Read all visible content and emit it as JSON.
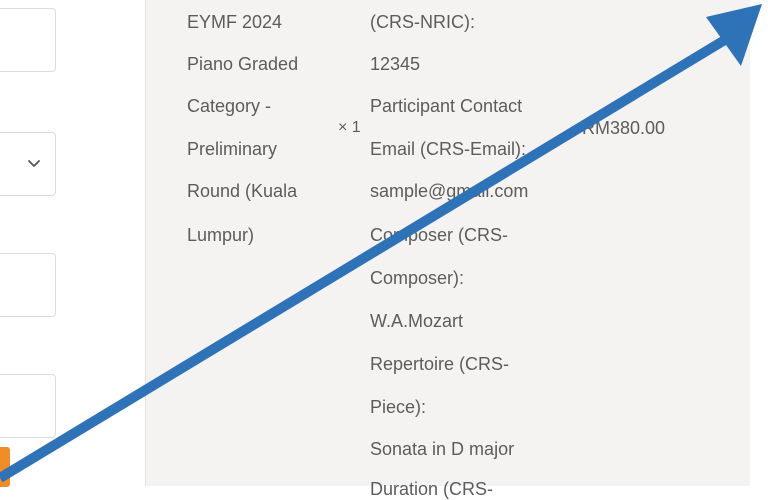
{
  "product": {
    "name_lines": [
      "EYMF 2024",
      "Piano Graded",
      "Category -",
      "Preliminary",
      "Round (Kuala",
      "Lumpur)"
    ],
    "quantity": "× 1",
    "price": "RM380.00"
  },
  "meta_lines": [
    "(CRS-NRIC):",
    "12345",
    "Participant Contact",
    "Email (CRS-Email):",
    "sample@gmail.com",
    "Composer (CRS-",
    "Composer):",
    "W.A.Mozart",
    "Repertoire (CRS-",
    "Piece):",
    "Sonata in D major",
    "Duration (CRS-"
  ],
  "colors": {
    "annotation_arrow": "#2e72b8",
    "accent_button": "#f28c28",
    "summary_bg": "#f4f3f1"
  },
  "icons": {
    "dropdown": "chevron-down-icon"
  }
}
